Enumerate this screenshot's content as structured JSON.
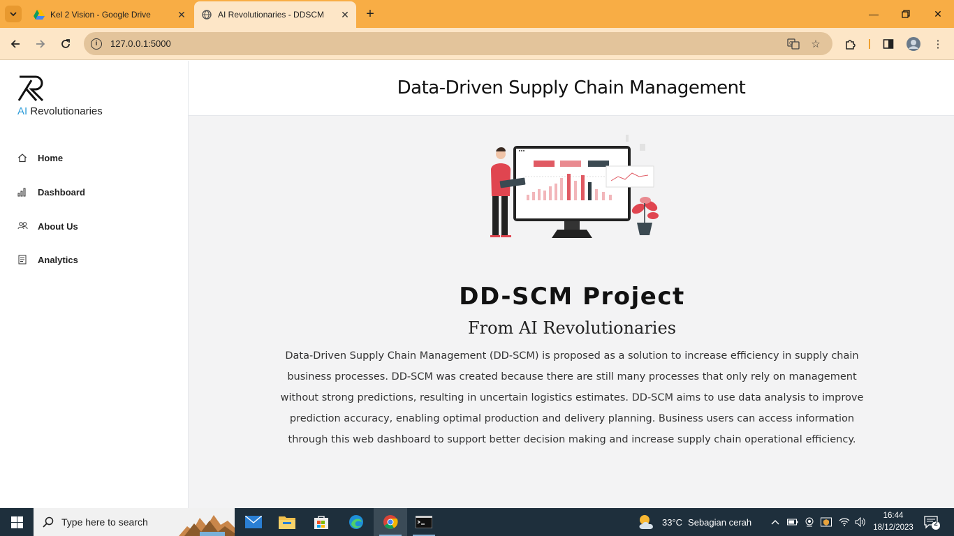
{
  "browser": {
    "tabs": [
      {
        "title": "Kel 2 Vision - Google Drive",
        "icon": "google-drive-icon",
        "active": false
      },
      {
        "title": "AI Revolutionaries - DDSCM",
        "icon": "globe-icon",
        "active": true
      }
    ],
    "url": "127.0.0.1:5000"
  },
  "sidebar": {
    "brand_prefix": "AI",
    "brand_suffix": " Revolutionaries",
    "items": [
      {
        "label": "Home",
        "icon": "home-icon"
      },
      {
        "label": "Dashboard",
        "icon": "bar-chart-icon"
      },
      {
        "label": "About Us",
        "icon": "people-icon"
      },
      {
        "label": "Analytics",
        "icon": "document-icon"
      }
    ]
  },
  "header": {
    "title": "Data-Driven Supply Chain Management"
  },
  "hero": {
    "title": "DD-SCM Project",
    "subtitle": "From AI Revolutionaries",
    "description": "Data-Driven Supply Chain Management (DD-SCM) is proposed as a solution to increase efficiency in supply chain business processes. DD-SCM was created because there are still many processes that only rely on management without strong predictions, resulting in uncertain logistics estimates. DD-SCM aims to use data analysis to improve prediction accuracy, enabling optimal production and delivery planning. Business users can access information through this web dashboard to support better decision making and increase supply chain operational efficiency."
  },
  "taskbar": {
    "search_placeholder": "Type here to search",
    "weather_temp": "33°C",
    "weather_text": "Sebagian cerah",
    "time": "16:44",
    "date": "18/12/2023",
    "notifications": "2"
  },
  "colors": {
    "tabstrip": "#f8ad45",
    "toolbar": "#fde6c7",
    "accent": "#2b9bd8",
    "taskbar": "#1e2f3c"
  }
}
